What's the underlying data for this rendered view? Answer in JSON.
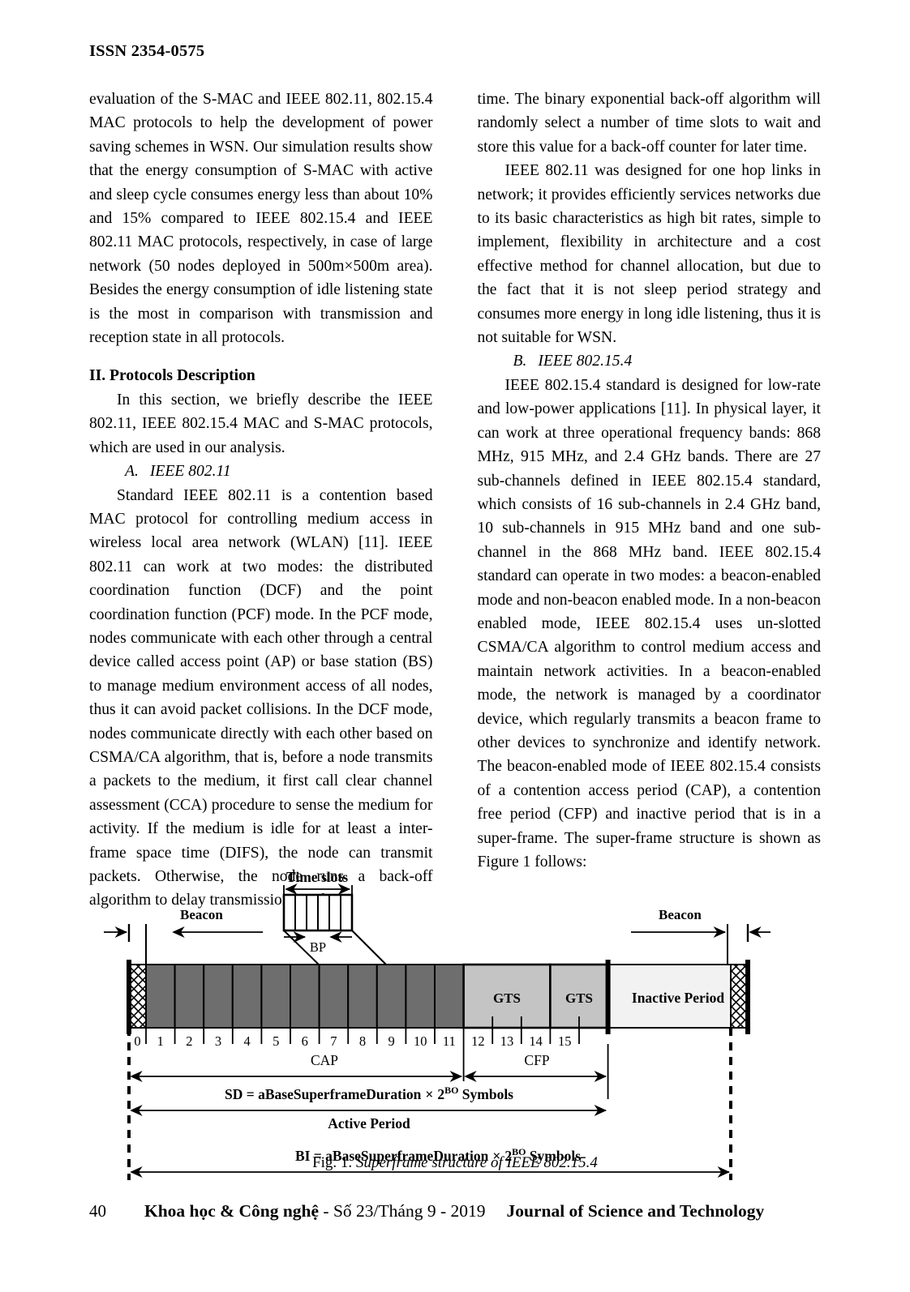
{
  "header": {
    "issn": "ISSN 2354-0575"
  },
  "left_column": {
    "paragraphs": [
      "evaluation of the S-MAC and IEEE 802.11, 802.15.4 MAC protocols to help the development of power saving schemes in WSN. Our simulation results show that the energy consumption of S-MAC with active and sleep cycle consumes energy less than about 10% and 15% compared to IEEE 802.15.4 and IEEE 802.11 MAC protocols, respectively, in case of large network (50 nodes deployed in 500m×500m area). Besides the energy consumption of idle listening state is the most in comparison with transmission and reception state in all protocols."
    ],
    "section_heading": "II. Protocols Description",
    "intro_paragraph": "In this section, we briefly describe the IEEE 802.11, IEEE 802.15.4 MAC and S-MAC protocols, which are used in our analysis.",
    "subsection_a_letter": "A.",
    "subsection_a_title": "IEEE 802.11",
    "subsection_a_paragraph": "Standard IEEE 802.11 is a contention based MAC protocol for controlling medium access in wireless local area network (WLAN) [11]. IEEE 802.11 can work at two modes: the distributed coordination function (DCF) and the point coordination function (PCF) mode. In the PCF mode, nodes communicate with each other through a central device called access point (AP) or base station (BS) to manage medium environment access of all nodes, thus it can avoid packet collisions. In the DCF mode, nodes communicate directly with each other based on CSMA/CA algorithm, that is, before a node transmits a packets to the medium, it first call clear channel assessment (CCA) procedure to sense the medium for activity. If the medium is idle for at least a inter-frame space time (DIFS), the node can transmit packets. Otherwise, the node runs a back-off algorithm to delay transmission to a later"
  },
  "right_column": {
    "continuation_paragraph": "time. The binary exponential back-off algorithm will randomly select a number of time slots to wait and store this value for a back-off counter for later time.",
    "paragraph_2": "IEEE 802.11 was designed for one hop links in network; it provides efficiently services networks due to its basic characteristics as high bit rates, simple to implement, flexibility in architecture and a cost effective method for channel allocation, but due to the fact that it is not sleep period strategy and consumes more energy in long idle listening, thus it is not suitable for WSN.",
    "subsection_b_letter": "B.",
    "subsection_b_title": "IEEE 802.15.4",
    "subsection_b_paragraph": "IEEE 802.15.4 standard is designed for low-rate and low-power applications [11]. In physical layer, it can work at three operational frequency bands: 868 MHz, 915 MHz, and 2.4 GHz bands. There are 27 sub-channels defined in IEEE 802.15.4 standard, which consists of 16 sub-channels in 2.4 GHz band, 10 sub-channels in 915 MHz band and one sub-channel in the 868 MHz band. IEEE 802.15.4 standard can operate in two modes: a beacon-enabled mode and non-beacon enabled mode. In a non-beacon enabled mode, IEEE 802.15.4 uses un-slotted CSMA/CA algorithm to control medium access and maintain network activities. In a beacon-enabled mode, the network is managed by a coordinator device, which regularly transmits a beacon frame to other devices to synchronize and identify network. The beacon-enabled mode of IEEE 802.15.4 consists of a contention access period (CAP), a contention free period (CFP) and inactive period that is in a super-frame. The super-frame structure is shown as Figure 1 follows:"
  },
  "figure": {
    "caption_number": "Fig. 1.",
    "caption_text": "Superframe structure of IEEE 802.15.4",
    "labels": {
      "time_slots": "Time slots",
      "bp": "BP",
      "beacon_left": "Beacon",
      "beacon_right": "Beacon",
      "gts_1": "GTS",
      "gts_2": "GTS",
      "inactive_period": "Inactive Period",
      "cap": "CAP",
      "cfp": "CFP",
      "active_period": "Active Period",
      "sd_formula": "SD = aBaseSuperframeDuration × 2",
      "sd_formula_sup": "BO",
      "sd_formula_tail": " Symbols",
      "bi_formula": "BI = aBaseSuperframeDuration × 2",
      "bi_formula_sup": "BO",
      "bi_formula_tail": " Symbols"
    },
    "slot_numbers": [
      "0",
      "1",
      "2",
      "3",
      "4",
      "5",
      "6",
      "7",
      "8",
      "9",
      "10",
      "11",
      "12",
      "13",
      "14",
      "15"
    ],
    "time_slot_subdivisions": 6,
    "colors": {
      "cap_fill": "#6e6e6e",
      "gts_fill": "#c4c4c4",
      "inactive_fill": "#f2f2f2",
      "beacon_hatch": "#ffffff",
      "stroke": "#000000"
    }
  },
  "footer": {
    "page_number": "40",
    "journal_vi_bold": "Khoa học & Công nghệ",
    "journal_vi_rest": " - Số 23/Tháng 9 - 2019",
    "journal_en": "Journal of Science and Technology"
  }
}
